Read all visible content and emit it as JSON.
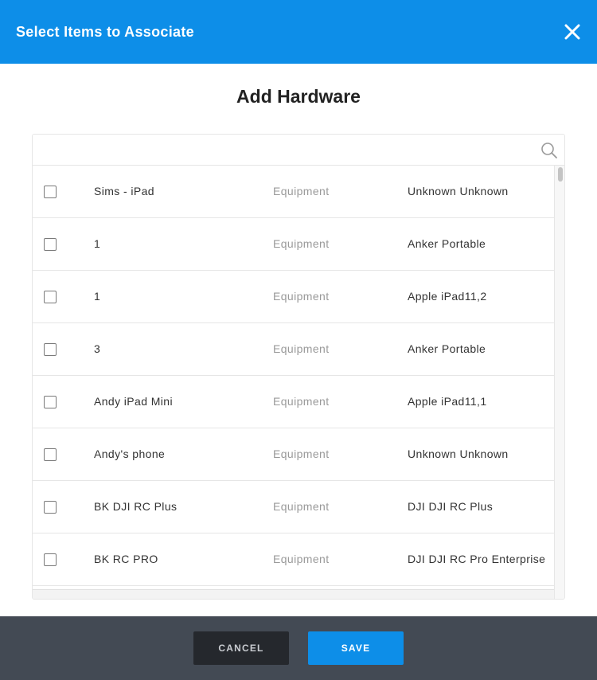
{
  "header": {
    "title": "Select Items to Associate",
    "close_icon": "close-icon"
  },
  "dialog": {
    "title": "Add Hardware"
  },
  "search": {
    "value": "",
    "placeholder": "",
    "icon": "search-icon"
  },
  "rows": [
    {
      "name": "Sims - iPad",
      "type": "Equipment",
      "model": "Unknown Unknown",
      "checked": false
    },
    {
      "name": "1",
      "type": "Equipment",
      "model": "Anker Portable",
      "checked": false
    },
    {
      "name": "1",
      "type": "Equipment",
      "model": "Apple iPad11,2",
      "checked": false
    },
    {
      "name": "3",
      "type": "Equipment",
      "model": "Anker Portable",
      "checked": false
    },
    {
      "name": "Andy iPad Mini",
      "type": "Equipment",
      "model": "Apple iPad11,1",
      "checked": false
    },
    {
      "name": "Andy's phone",
      "type": "Equipment",
      "model": "Unknown Unknown",
      "checked": false
    },
    {
      "name": "BK DJI RC Plus",
      "type": "Equipment",
      "model": "DJI DJI RC Plus",
      "checked": false
    },
    {
      "name": "BK RC PRO",
      "type": "Equipment",
      "model": "DJI DJI RC Pro Enterprise",
      "checked": false
    }
  ],
  "footer": {
    "cancel_label": "CANCEL",
    "save_label": "SAVE"
  },
  "colors": {
    "header_bg": "#0d8ee8",
    "footer_bg": "#434a54",
    "save_bg": "#0d8ee8",
    "cancel_bg": "#25282d"
  }
}
